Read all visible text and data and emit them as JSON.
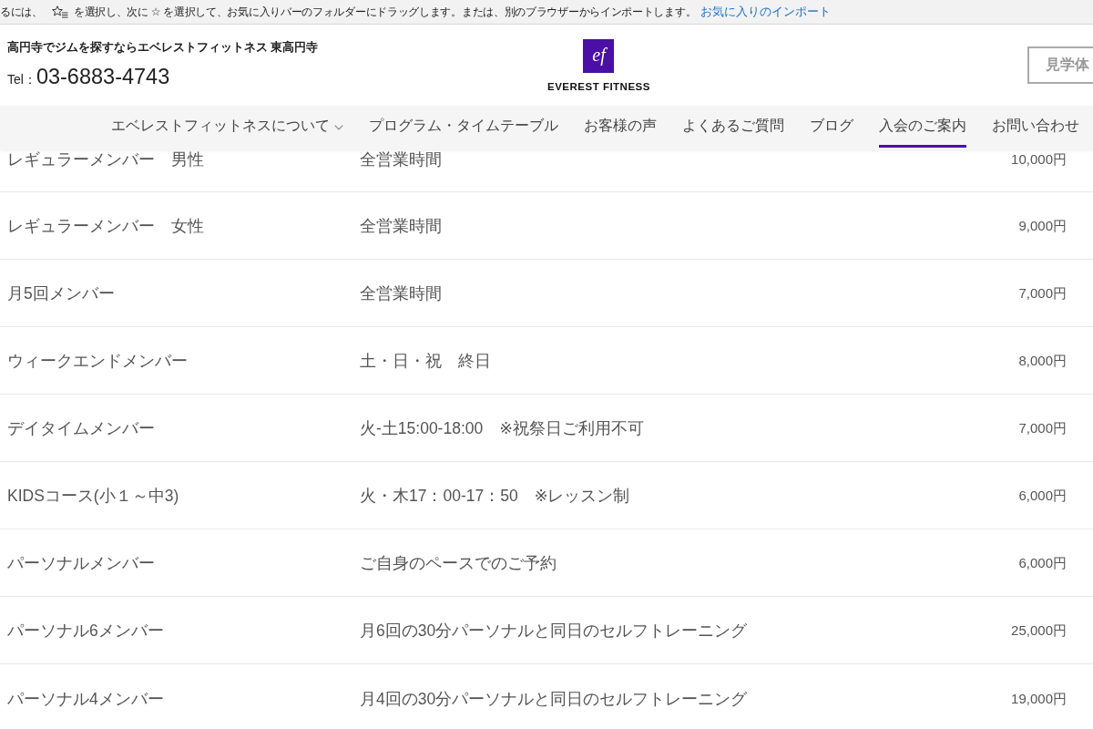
{
  "favorites_bar": {
    "text_before_icon": "るには、",
    "text_after_icon": "を選択し、次に ☆ を選択して、お気に入りバーのフォルダーにドラッグします。または、別のブラウザーからインポートします。",
    "link": "お気に入りのインポート"
  },
  "header": {
    "tagline": "高円寺でジムを探すならエベレストフィットネス 東高円寺",
    "tel_label": "Tel：",
    "tel_number": "03-6883-4743",
    "logo": {
      "monogram": "ef",
      "name": "EVEREST FITNESS"
    },
    "button": "見学体"
  },
  "nav": {
    "items": [
      {
        "label": "エベレストフィットネスについて",
        "kind": "dropdown",
        "selected": false
      },
      {
        "label": "プログラム・タイムテーブル",
        "kind": "link",
        "selected": false
      },
      {
        "label": "お客様の声",
        "kind": "link",
        "selected": false
      },
      {
        "label": "よくあるご質問",
        "kind": "link",
        "selected": false
      },
      {
        "label": "ブログ",
        "kind": "link",
        "selected": false
      },
      {
        "label": "入会のご案内",
        "kind": "link",
        "selected": true
      },
      {
        "label": "お問い合わせ",
        "kind": "link",
        "selected": false
      }
    ]
  },
  "table": {
    "rows": [
      {
        "column_1": "レギュラーメンバー　男性",
        "column_2": "全営業時間",
        "column_3": "10,000円"
      },
      {
        "column_1": "レギュラーメンバー　女性",
        "column_2": "全営業時間",
        "column_3": "9,000円"
      },
      {
        "column_1": "月5回メンバー",
        "column_2": "全営業時間",
        "column_3": "7,000円"
      },
      {
        "column_1": "ウィークエンドメンバー",
        "column_2": "土・日・祝　終日",
        "column_3": "8,000円"
      },
      {
        "column_1": "デイタイムメンバー",
        "column_2": "火-土15:00-18:00　※祝祭日ご利用不可",
        "column_3": "7,000円"
      },
      {
        "column_1": "KIDSコース(小１～中3)",
        "column_2": "火・木17：00-17：50　※レッスン制",
        "column_3": "6,000円"
      },
      {
        "column_1": "パーソナルメンバー",
        "column_2": "ご自身のペースでのご予約",
        "column_3": "6,000円"
      },
      {
        "column_1": "パーソナル6メンバー",
        "column_2": "月6回の30分パーソナルと同日のセルフトレーニング",
        "column_3": "25,000円"
      },
      {
        "column_1": "パーソナル4メンバー",
        "column_2": "月4回の30分パーソナルと同日のセルフトレーニング",
        "column_3": "19,000円"
      }
    ]
  }
}
